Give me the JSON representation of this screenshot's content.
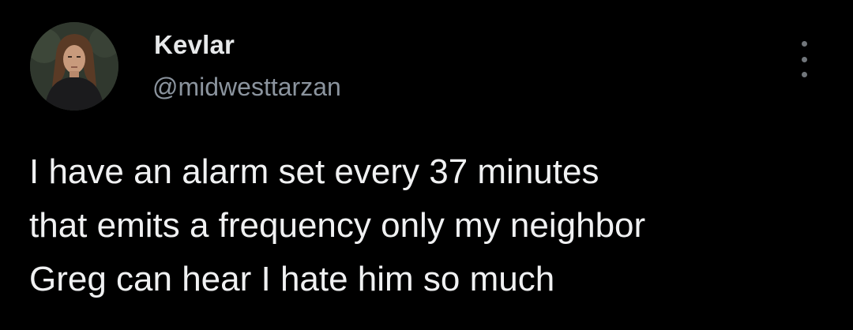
{
  "author": {
    "display_name": "Kevlar",
    "handle": "@midwesttarzan",
    "avatar_icon": "profile-photo"
  },
  "menu": {
    "icon": "more-vertical-icon"
  },
  "tweet": {
    "text_lines": [
      "I have an alarm set every 37 minutes",
      "that emits a frequency only my neighbor",
      "Greg can hear I hate him so much"
    ]
  },
  "colors": {
    "background": "#000000",
    "primary_text": "#e7e9ea",
    "secondary_text": "#8b949e"
  }
}
